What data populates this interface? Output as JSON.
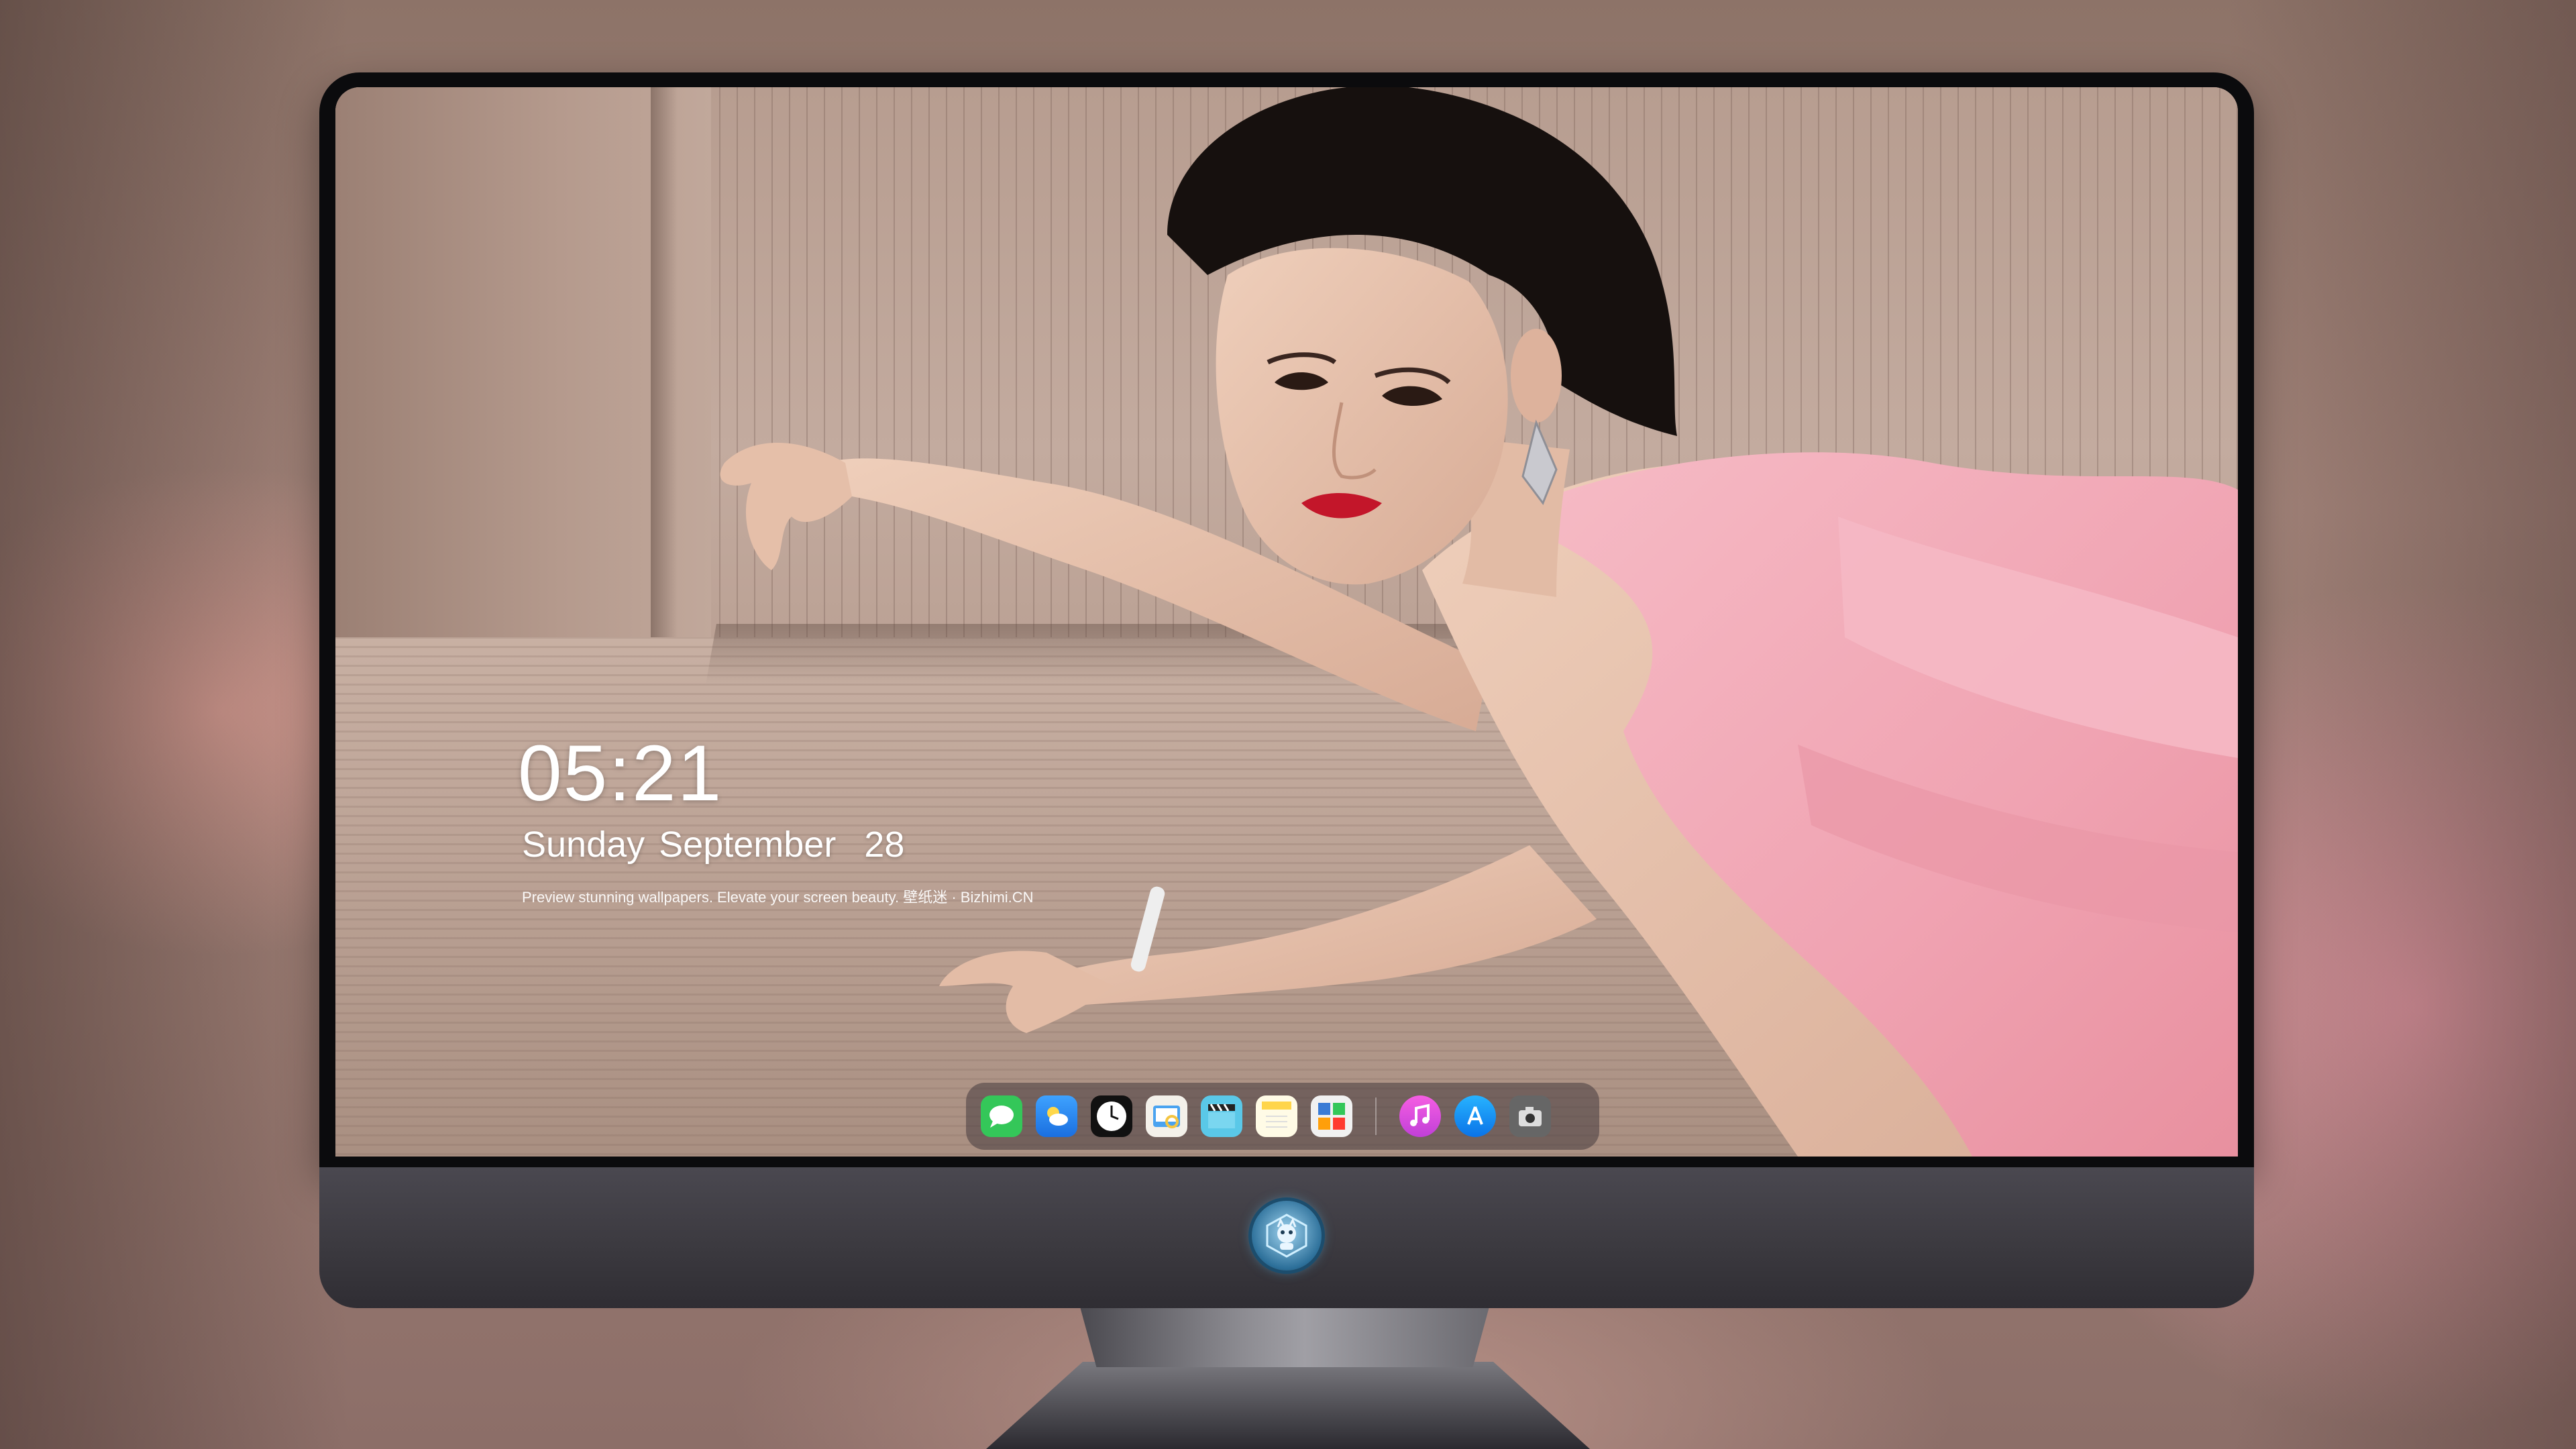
{
  "lock_screen": {
    "time": "05:21",
    "date": "Sunday September  28",
    "tagline": "Preview stunning wallpapers. Elevate your screen beauty. 壁纸迷 · Bizhimi.CN"
  },
  "dock": {
    "apps": [
      {
        "icon": "messages-icon",
        "color": "#34c759"
      },
      {
        "icon": "weather-icon",
        "color": "#2b8cf5"
      },
      {
        "icon": "clock-icon",
        "color": "#111111"
      },
      {
        "icon": "preview-icon",
        "color": "#f4c542"
      },
      {
        "icon": "video-icon",
        "color": "#5ac8e8"
      },
      {
        "icon": "notes-icon",
        "color": "#ffd54a"
      },
      {
        "icon": "photo-booth-icon",
        "color": "#3a7bd5"
      },
      {
        "icon": "music-icon",
        "color": "#e84fd0"
      },
      {
        "icon": "app-store-icon",
        "color": "#1a8cff"
      },
      {
        "icon": "camera-icon",
        "color": "#555555"
      }
    ]
  },
  "colors": {
    "dress": "#f1a7b5",
    "skin": "#e6c2ae",
    "sofa": "#b9a093",
    "bezel": "#0b0b0d",
    "chin": "#3c3a40"
  }
}
